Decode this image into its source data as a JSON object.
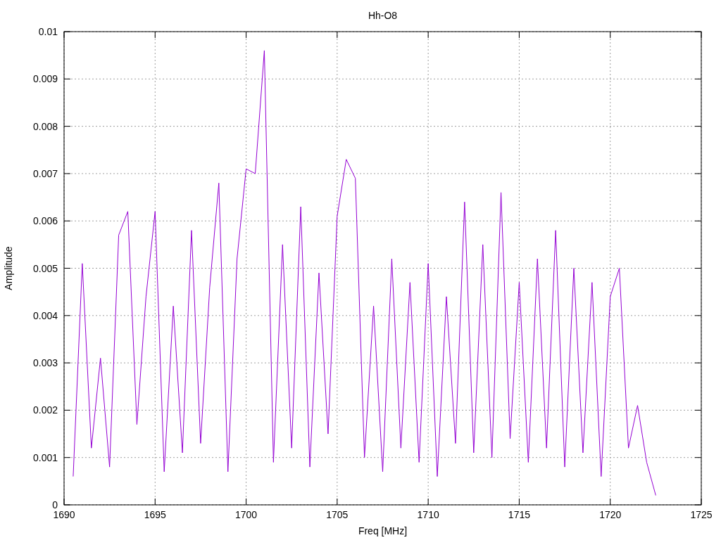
{
  "chart": {
    "chart_data": {
      "type": "line",
      "title": "Hh-O8",
      "xlabel": "Freq [MHz]",
      "ylabel": "Amplitude",
      "grid": true,
      "xlim": [
        1690,
        1725
      ],
      "ylim": [
        0,
        0.01
      ],
      "xticks": [
        1690,
        1695,
        1700,
        1705,
        1710,
        1715,
        1720,
        1725
      ],
      "yticks": [
        0,
        0.001,
        0.002,
        0.003,
        0.004,
        0.005,
        0.006,
        0.007,
        0.008,
        0.009,
        0.01
      ],
      "x": [
        1690.5,
        1691,
        1691.5,
        1692,
        1692.5,
        1693,
        1693.5,
        1694,
        1694.5,
        1695,
        1695.5,
        1696,
        1696.5,
        1697,
        1697.5,
        1698,
        1698.5,
        1699,
        1699.5,
        1700,
        1700.5,
        1701,
        1701.5,
        1702,
        1702.5,
        1703,
        1703.5,
        1704,
        1704.5,
        1705,
        1705.5,
        1706,
        1706.5,
        1707,
        1707.5,
        1708,
        1708.5,
        1709,
        1709.5,
        1710,
        1710.5,
        1711,
        1711.5,
        1712,
        1712.5,
        1713,
        1713.5,
        1714,
        1714.5,
        1715,
        1715.5,
        1716,
        1716.5,
        1717,
        1717.5,
        1718,
        1718.5,
        1719,
        1719.5,
        1720,
        1720.5,
        1721,
        1721.5,
        1722,
        1722.5
      ],
      "series": [
        {
          "color": "#9400d3",
          "values": [
            0.0006,
            0.0051,
            0.0012,
            0.0031,
            0.0008,
            0.0057,
            0.0062,
            0.0017,
            0.0044,
            0.0062,
            0.0007,
            0.0042,
            0.0011,
            0.0058,
            0.0013,
            0.0046,
            0.0068,
            0.0007,
            0.0052,
            0.0071,
            0.007,
            0.0096,
            0.0009,
            0.0055,
            0.0012,
            0.0063,
            0.0008,
            0.0049,
            0.0015,
            0.0061,
            0.0073,
            0.0069,
            0.001,
            0.0042,
            0.0007,
            0.0052,
            0.0012,
            0.0047,
            0.0009,
            0.0051,
            0.0006,
            0.0044,
            0.0013,
            0.0064,
            0.0011,
            0.0055,
            0.001,
            0.0066,
            0.0014,
            0.0047,
            0.0009,
            0.0052,
            0.0012,
            0.0058,
            0.0008,
            0.005,
            0.0011,
            0.0047,
            0.0006,
            0.0044,
            0.005,
            0.0012,
            0.0021,
            0.0009,
            0.0002
          ]
        }
      ]
    }
  }
}
